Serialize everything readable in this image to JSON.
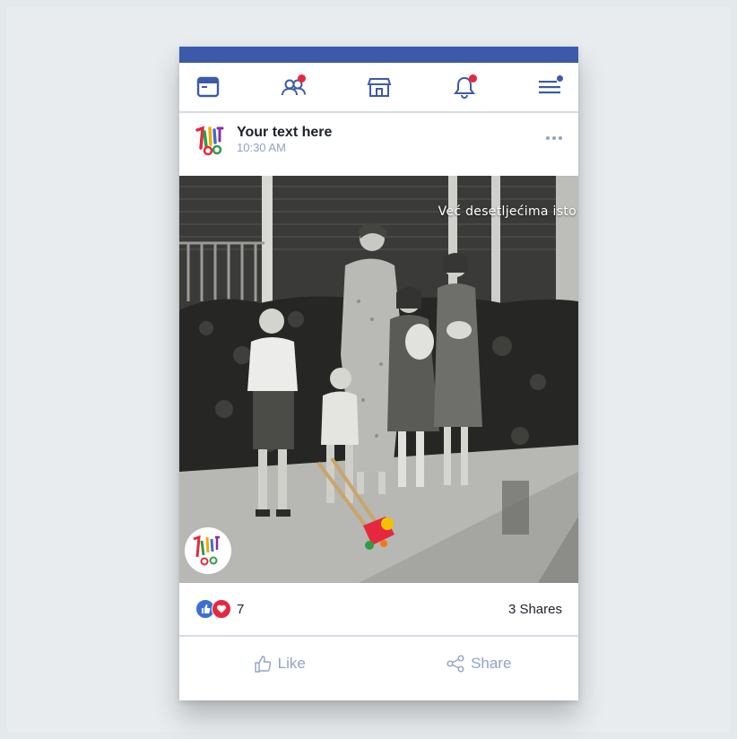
{
  "nav": {
    "icons": [
      "home-icon",
      "friends-icon",
      "marketplace-icon",
      "notifications-icon",
      "menu-icon"
    ],
    "accent": "#3b5aa9",
    "badge_color": "#e6283e"
  },
  "post": {
    "author": "Your text here",
    "time": "10:30 AM",
    "photo_caption": "Već desetljećima isto",
    "reaction_count": "7",
    "shares": "3 Shares",
    "like_label": "Like",
    "share_label": "Share"
  }
}
